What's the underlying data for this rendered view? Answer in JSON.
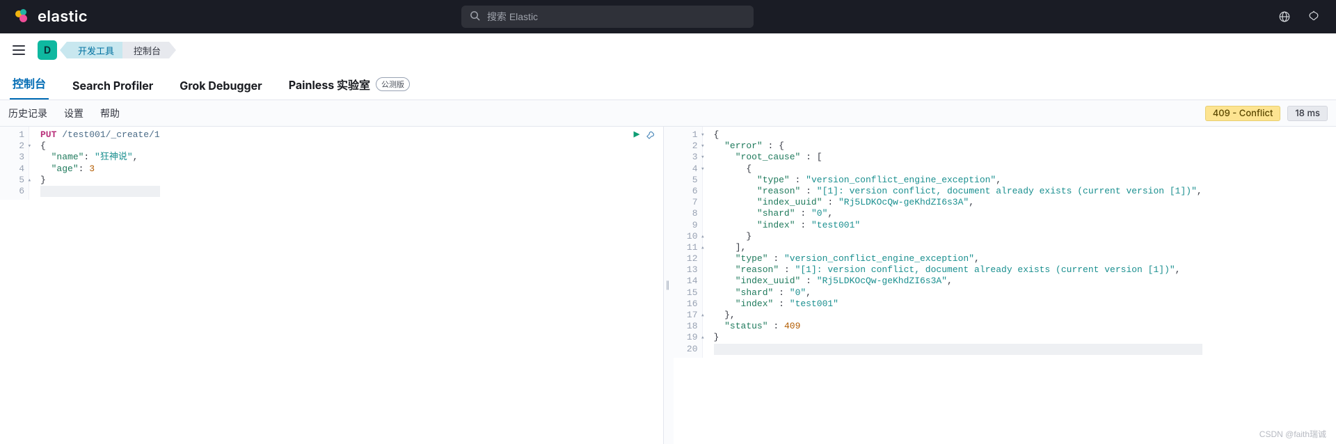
{
  "header": {
    "brand": "elastic",
    "search_placeholder": "搜索 Elastic"
  },
  "nav": {
    "app_badge": "D",
    "crumb_primary": "开发工具",
    "crumb_secondary": "控制台"
  },
  "tabs": {
    "console": "控制台",
    "profiler": "Search Profiler",
    "grok": "Grok Debugger",
    "painless": "Painless 实验室",
    "beta": "公测版"
  },
  "toolbar": {
    "history": "历史记录",
    "settings": "设置",
    "help": "帮助",
    "status": "409 - Conflict",
    "time": "18 ms"
  },
  "request": {
    "lines": [
      {
        "n": "1",
        "fold": "",
        "html": "<span class='tok-method'>PUT</span> <span class='tok-path'>/test001/_create/1</span>"
      },
      {
        "n": "2",
        "fold": "fold",
        "html": "<span class='tok-punc'>{</span>"
      },
      {
        "n": "3",
        "fold": "",
        "html": "  <span class='tok-key'>\"name\"</span><span class='tok-punc'>:</span> <span class='tok-string'>\"狂神说\"</span><span class='tok-punc'>,</span>"
      },
      {
        "n": "4",
        "fold": "",
        "html": "  <span class='tok-key'>\"age\"</span><span class='tok-punc'>:</span> <span class='tok-num'>3</span>"
      },
      {
        "n": "5",
        "fold": "foldup",
        "html": "<span class='tok-punc'>}</span>"
      },
      {
        "n": "6",
        "fold": "",
        "html": "",
        "current": true
      }
    ]
  },
  "response": {
    "lines": [
      {
        "n": "1",
        "fold": "fold",
        "html": "<span class='tok-punc'>{</span>"
      },
      {
        "n": "2",
        "fold": "fold",
        "html": "  <span class='tok-key'>\"error\"</span> <span class='tok-punc'>:</span> <span class='tok-punc'>{</span>"
      },
      {
        "n": "3",
        "fold": "fold",
        "html": "    <span class='tok-key'>\"root_cause\"</span> <span class='tok-punc'>:</span> <span class='tok-punc'>[</span>"
      },
      {
        "n": "4",
        "fold": "fold",
        "html": "      <span class='tok-punc'>{</span>"
      },
      {
        "n": "5",
        "fold": "",
        "html": "        <span class='tok-key'>\"type\"</span> <span class='tok-punc'>:</span> <span class='tok-string'>\"version_conflict_engine_exception\"</span><span class='tok-punc'>,</span>"
      },
      {
        "n": "6",
        "fold": "",
        "html": "        <span class='tok-key'>\"reason\"</span> <span class='tok-punc'>:</span> <span class='tok-string'>\"[1]: version conflict, document already exists (current version [1])\"</span><span class='tok-punc'>,</span>"
      },
      {
        "n": "7",
        "fold": "",
        "html": "        <span class='tok-key'>\"index_uuid\"</span> <span class='tok-punc'>:</span> <span class='tok-string'>\"Rj5LDKOcQw-geKhdZI6s3A\"</span><span class='tok-punc'>,</span>"
      },
      {
        "n": "8",
        "fold": "",
        "html": "        <span class='tok-key'>\"shard\"</span> <span class='tok-punc'>:</span> <span class='tok-string'>\"0\"</span><span class='tok-punc'>,</span>"
      },
      {
        "n": "9",
        "fold": "",
        "html": "        <span class='tok-key'>\"index\"</span> <span class='tok-punc'>:</span> <span class='tok-string'>\"test001\"</span>"
      },
      {
        "n": "10",
        "fold": "foldup",
        "html": "      <span class='tok-punc'>}</span>"
      },
      {
        "n": "11",
        "fold": "foldup",
        "html": "    <span class='tok-punc'>],</span>"
      },
      {
        "n": "12",
        "fold": "",
        "html": "    <span class='tok-key'>\"type\"</span> <span class='tok-punc'>:</span> <span class='tok-string'>\"version_conflict_engine_exception\"</span><span class='tok-punc'>,</span>"
      },
      {
        "n": "13",
        "fold": "",
        "html": "    <span class='tok-key'>\"reason\"</span> <span class='tok-punc'>:</span> <span class='tok-string'>\"[1]: version conflict, document already exists (current version [1])\"</span><span class='tok-punc'>,</span>"
      },
      {
        "n": "14",
        "fold": "",
        "html": "    <span class='tok-key'>\"index_uuid\"</span> <span class='tok-punc'>:</span> <span class='tok-string'>\"Rj5LDKOcQw-geKhdZI6s3A\"</span><span class='tok-punc'>,</span>"
      },
      {
        "n": "15",
        "fold": "",
        "html": "    <span class='tok-key'>\"shard\"</span> <span class='tok-punc'>:</span> <span class='tok-string'>\"0\"</span><span class='tok-punc'>,</span>"
      },
      {
        "n": "16",
        "fold": "",
        "html": "    <span class='tok-key'>\"index\"</span> <span class='tok-punc'>:</span> <span class='tok-string'>\"test001\"</span>"
      },
      {
        "n": "17",
        "fold": "foldup",
        "html": "  <span class='tok-punc'>},</span>"
      },
      {
        "n": "18",
        "fold": "",
        "html": "  <span class='tok-key'>\"status\"</span> <span class='tok-punc'>:</span> <span class='tok-num'>409</span>"
      },
      {
        "n": "19",
        "fold": "foldup",
        "html": "<span class='tok-punc'>}</span>"
      },
      {
        "n": "20",
        "fold": "",
        "html": "",
        "current": true
      }
    ]
  },
  "watermark": "CSDN @faith瑞诚"
}
